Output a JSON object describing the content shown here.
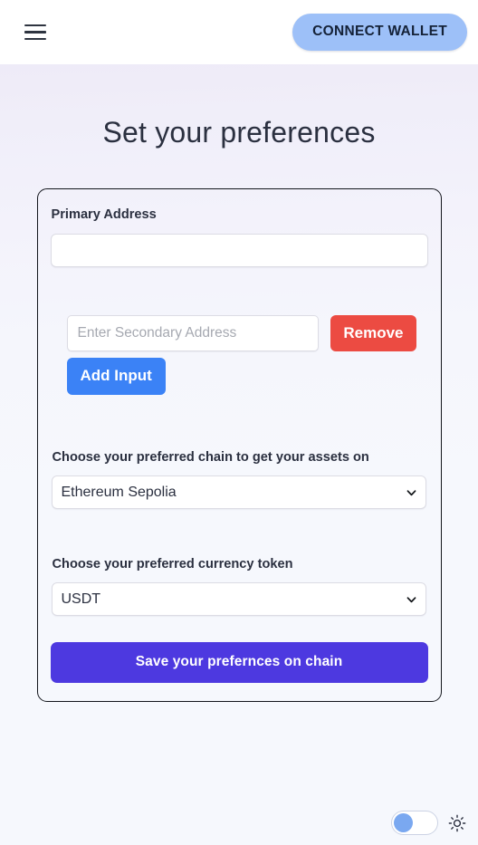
{
  "header": {
    "menu_icon": "hamburger-icon",
    "connect_wallet_label": "CONNECT WALLET",
    "connect_wallet_bg": "#9dc0f8",
    "connect_wallet_text_color": "#152238"
  },
  "page": {
    "title": "Set your preferences",
    "title_color": "#2b3040",
    "background_top": "#f3eef8",
    "background_bottom": "#f6f8fd"
  },
  "form": {
    "primary_address": {
      "label": "Primary Address",
      "value": "",
      "placeholder": ""
    },
    "secondary_address": {
      "value": "",
      "placeholder": "Enter Secondary Address",
      "remove_label": "Remove",
      "remove_color": "#ec4b42"
    },
    "add_input_label": "Add Input",
    "add_input_color": "#3b82f6",
    "chain": {
      "label": "Choose your preferred chain to get your assets on",
      "selected": "Ethereum Sepolia",
      "options": [
        "Ethereum Sepolia"
      ]
    },
    "currency": {
      "label": "Choose your preferred currency token",
      "selected": "USDT",
      "options": [
        "USDT"
      ]
    },
    "save_label": "Save your prefernces on chain",
    "save_color": "#4d39e0",
    "card_border_color": "#13161c"
  },
  "theme": {
    "toggle_state": "off",
    "toggle_knob_color": "#7aa8f0",
    "sun_icon": "sun-icon"
  }
}
